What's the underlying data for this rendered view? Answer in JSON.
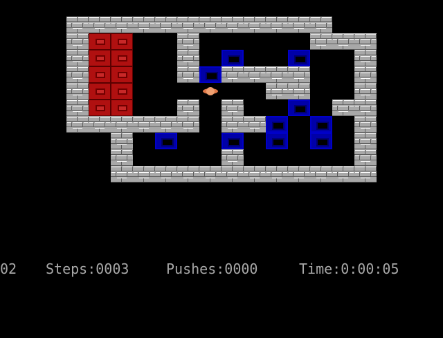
{
  "board": {
    "map": [
      "...############.....",
      "...#  #  ########...",
      "...#  #  #........#.",
      "...#  #  #.#......#.",
      "...#  #  #..#.....#.",
      "...#  #...........#.",
      "...#  #..#.#.....#..",
      "...##########...#...",
      ".....#...........#..",
      ".....#...#.......#..",
      ".....##############.."
    ],
    "tile_legend": {
      "wall": "#",
      "goal": "G",
      "box": "B",
      "player": "@",
      "floor": "."
    }
  },
  "pieces": {
    "goals": [
      [
        4,
        2
      ],
      [
        5,
        2
      ],
      [
        4,
        3
      ],
      [
        5,
        3
      ],
      [
        4,
        4
      ],
      [
        5,
        4
      ],
      [
        4,
        5
      ],
      [
        5,
        5
      ],
      [
        4,
        6
      ],
      [
        5,
        6
      ]
    ],
    "boxes": [
      [
        10,
        3
      ],
      [
        13,
        3
      ],
      [
        9,
        4
      ],
      [
        13,
        6
      ],
      [
        12,
        7
      ],
      [
        14,
        7
      ],
      [
        7,
        8
      ],
      [
        10,
        8
      ],
      [
        12,
        8
      ],
      [
        14,
        8
      ]
    ],
    "player": [
      9,
      5
    ]
  },
  "colors": {
    "background": "#000000",
    "wall": "#a8a8a8",
    "goal": "#b01010",
    "box": "#0000a8",
    "player": "#e07848",
    "status_text": "#a8a8a8"
  },
  "status": {
    "level": "02",
    "steps": "Steps:0003",
    "pushes": "Pushes:0000",
    "time": "Time:0:00:05"
  }
}
